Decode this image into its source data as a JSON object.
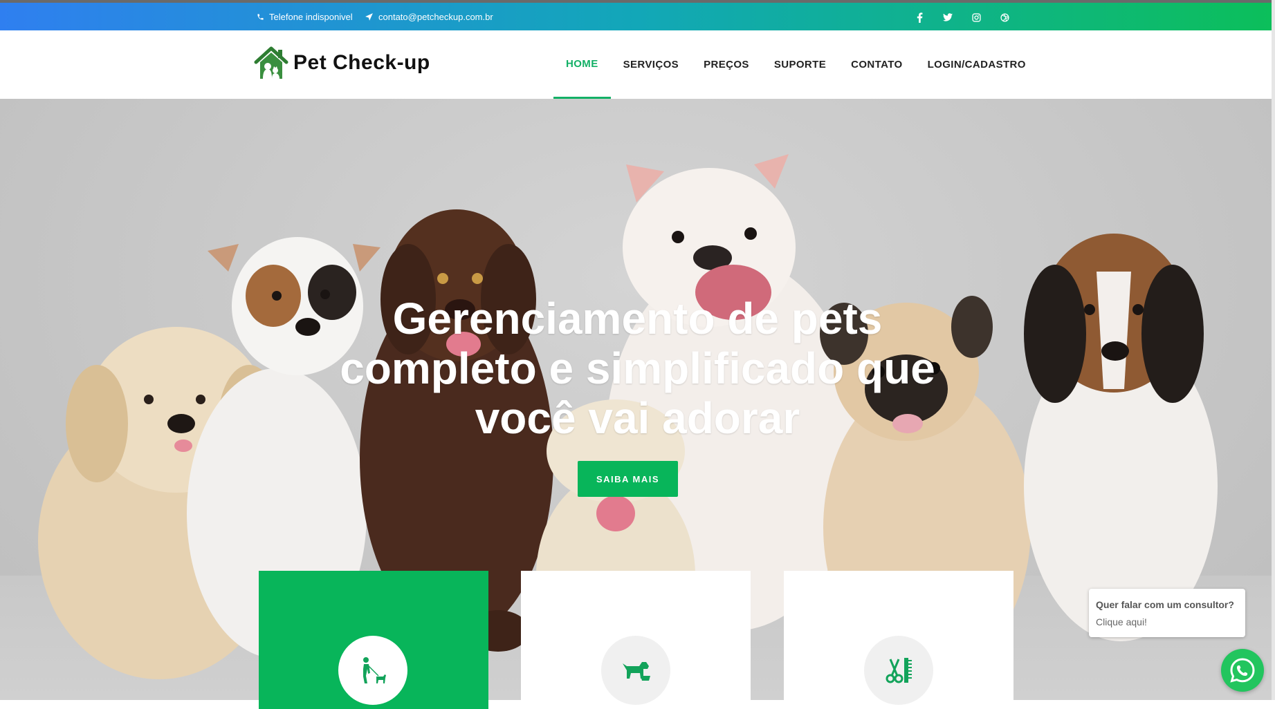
{
  "topbar": {
    "phone": "Telefone indisponivel",
    "email": "contato@petcheckup.com.br",
    "social_icons": [
      "facebook-icon",
      "twitter-icon",
      "instagram-icon",
      "dribbble-icon"
    ]
  },
  "header": {
    "logo_text": "Pet Check-up",
    "nav": [
      {
        "label": "HOME",
        "active": true
      },
      {
        "label": "SERVIÇOS",
        "active": false
      },
      {
        "label": "PREÇOS",
        "active": false
      },
      {
        "label": "SUPORTE",
        "active": false
      },
      {
        "label": "CONTATO",
        "active": false
      },
      {
        "label": "LOGIN/CADASTRO",
        "active": false
      }
    ]
  },
  "hero": {
    "title_line1": "Gerenciamento de pets",
    "title_line2": "completo e simplificado que",
    "title_line3": "você vai adorar",
    "button": "SAIBA MAIS"
  },
  "features": {
    "icons": [
      "dog-walking-icon",
      "dog-feeding-icon",
      "grooming-icon"
    ]
  },
  "chat": {
    "title": "Quer falar com um consultor?",
    "subtitle": "Clique aqui!"
  },
  "colors": {
    "accent": "#08b55a",
    "nav_active": "#13b066",
    "gradient_start": "#2f7ff0",
    "gradient_end": "#0cbf5a"
  }
}
